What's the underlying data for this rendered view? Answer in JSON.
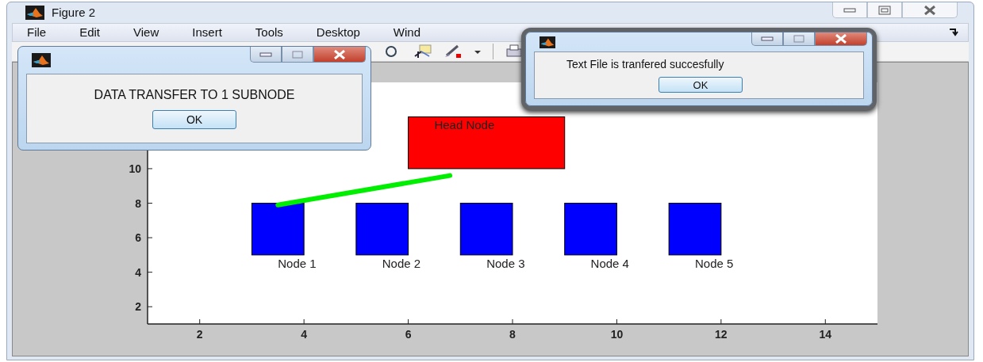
{
  "window": {
    "title": "Figure 2"
  },
  "menu": [
    "File",
    "Edit",
    "View",
    "Insert",
    "Tools",
    "Desktop",
    "Wind"
  ],
  "figure": {
    "x_tick_labels": [
      "2",
      "4",
      "6",
      "8",
      "10",
      "12",
      "14"
    ],
    "y_tick_labels": [
      "10",
      "8",
      "6",
      "4",
      "2"
    ],
    "head_node": {
      "label": "Head Node"
    },
    "nodes": [
      {
        "label": "Node 1"
      },
      {
        "label": "Node 2"
      },
      {
        "label": "Node 3"
      },
      {
        "label": "Node 4"
      },
      {
        "label": "Node 5"
      }
    ]
  },
  "dialogs": [
    {
      "message": "DATA TRANSFER TO 1 SUBNODE",
      "button": "OK"
    },
    {
      "message": "Text File is tranfered succesfully",
      "button": "OK"
    }
  ]
}
